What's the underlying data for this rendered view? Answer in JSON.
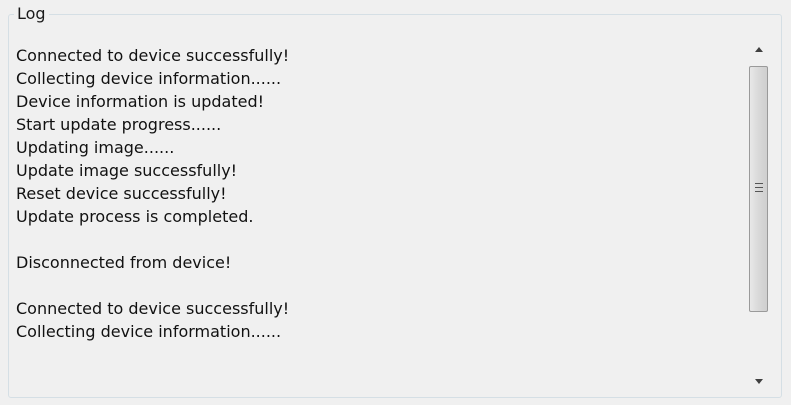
{
  "groupbox": {
    "title": "Log"
  },
  "log": {
    "lines": [
      "Connected to device successfully!",
      "Collecting device information......",
      "Device information is updated!",
      "Start update progress......",
      "Updating image......",
      "Update image successfully!",
      "Reset device successfully!",
      "Update process is completed.",
      "",
      "Disconnected from device!",
      "",
      "Connected to device successfully!",
      "Collecting device information......"
    ]
  },
  "scrollbar": {
    "up_icon": "scroll-up-arrow-icon",
    "down_icon": "scroll-down-arrow-icon",
    "grip_icon": "scroll-grip-icon"
  }
}
